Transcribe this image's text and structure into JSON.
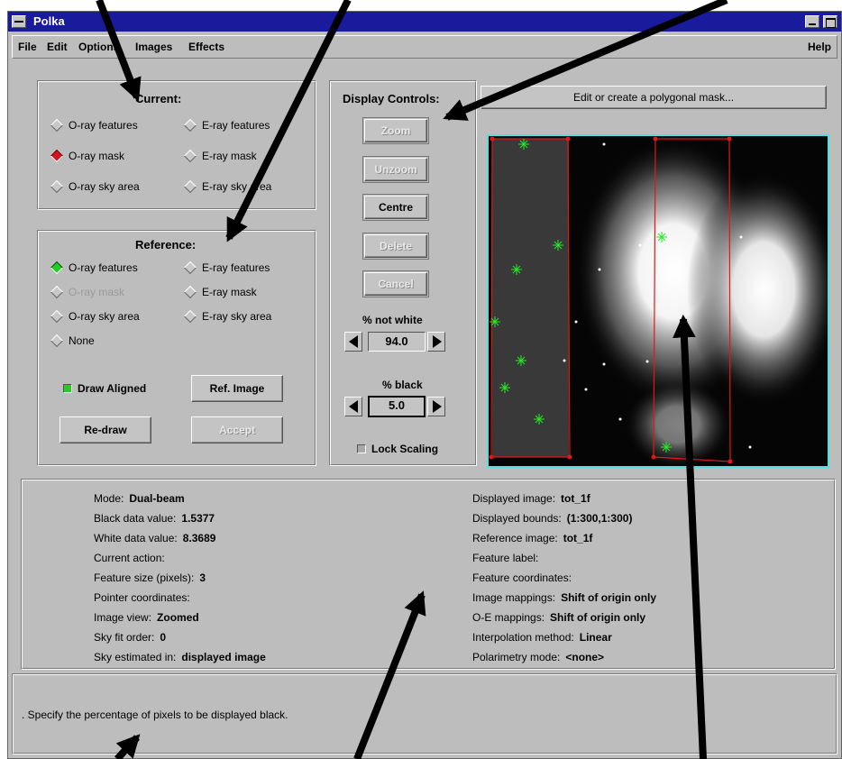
{
  "window": {
    "title": "Polka"
  },
  "menu": {
    "items": [
      "File",
      "Edit",
      "Options",
      "Images",
      "Effects"
    ],
    "help": "Help"
  },
  "current": {
    "title": "Current:",
    "options": [
      {
        "label": "O-ray features",
        "state": "off"
      },
      {
        "label": "E-ray features",
        "state": "off"
      },
      {
        "label": "O-ray mask",
        "state": "selected"
      },
      {
        "label": "E-ray mask",
        "state": "off"
      },
      {
        "label": "O-ray sky area",
        "state": "off"
      },
      {
        "label": "E-ray sky area",
        "state": "off"
      }
    ]
  },
  "reference": {
    "title": "Reference:",
    "options": [
      {
        "label": "O-ray features",
        "state": "selected"
      },
      {
        "label": "E-ray features",
        "state": "off"
      },
      {
        "label": "O-ray mask",
        "state": "disabled"
      },
      {
        "label": "E-ray mask",
        "state": "off"
      },
      {
        "label": "O-ray sky area",
        "state": "off"
      },
      {
        "label": "E-ray sky area",
        "state": "off"
      },
      {
        "label": "None",
        "state": "off"
      }
    ],
    "draw_aligned": {
      "label": "Draw Aligned",
      "checked": true
    },
    "ref_image_button": "Ref. Image",
    "redraw_button": "Re-draw",
    "accept_button": "Accept"
  },
  "display_controls": {
    "title": "Display Controls:",
    "buttons": [
      {
        "label": "Zoom",
        "enabled": false
      },
      {
        "label": "Unzoom",
        "enabled": false
      },
      {
        "label": "Centre",
        "enabled": true
      },
      {
        "label": "Delete",
        "enabled": false
      },
      {
        "label": "Cancel",
        "enabled": false
      }
    ],
    "not_white": {
      "label": "% not white",
      "value": "94.0"
    },
    "black": {
      "label": "% black",
      "value": "5.0"
    },
    "lock_scaling": {
      "label": "Lock Scaling",
      "checked": false
    }
  },
  "image_header_button": "Edit or create a polygonal mask...",
  "image_view": {
    "colors": {
      "mask": "#e01818",
      "feature": "#22ee22",
      "frame": "#50e0e0"
    }
  },
  "info": {
    "left": [
      {
        "label": "Mode:",
        "value": "Dual-beam"
      },
      {
        "label": "Black data value:",
        "value": "1.5377"
      },
      {
        "label": "White data value:",
        "value": "8.3689"
      },
      {
        "label": "Current action:",
        "value": ""
      },
      {
        "label": "Feature size (pixels):",
        "value": "3"
      },
      {
        "label": "Pointer coordinates:",
        "value": ""
      },
      {
        "label": "Image view:",
        "value": "Zoomed"
      },
      {
        "label": "Sky fit order:",
        "value": "0"
      },
      {
        "label": "Sky estimated in:",
        "value": "displayed image"
      }
    ],
    "right": [
      {
        "label": "Displayed image:",
        "value": "tot_1f"
      },
      {
        "label": "Displayed bounds:",
        "value": "(1:300,1:300)"
      },
      {
        "label": "Reference image:",
        "value": "tot_1f"
      },
      {
        "label": "Feature label:",
        "value": ""
      },
      {
        "label": "Feature coordinates:",
        "value": ""
      },
      {
        "label": "Image mappings:",
        "value": "Shift of origin only"
      },
      {
        "label": "O-E mappings:",
        "value": "Shift of origin only"
      },
      {
        "label": "Interpolation method:",
        "value": "Linear"
      },
      {
        "label": "Polarimetry mode:",
        "value": "<none>"
      }
    ]
  },
  "status": {
    "message": ". Specify the percentage of pixels to be displayed black."
  }
}
